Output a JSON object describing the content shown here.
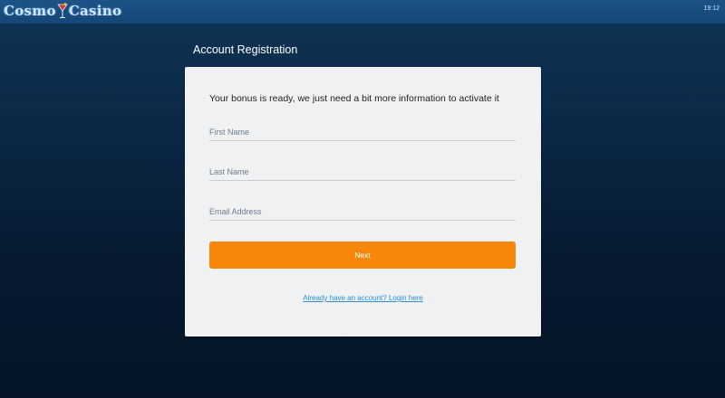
{
  "header": {
    "logo_text_left": "Cosmo",
    "logo_text_right": "Casino",
    "clock": "19:12"
  },
  "page": {
    "title": "Account Registration"
  },
  "form": {
    "heading": "Your bonus is ready, we just need a bit more information to activate it",
    "first_name_placeholder": "First Name",
    "last_name_placeholder": "Last Name",
    "email_placeholder": "Email Address",
    "next_label": "Next",
    "login_link": "Already have an account? Login here"
  },
  "colors": {
    "accent_button": "#f7870a",
    "link": "#2d8fd0",
    "topbar": "#1a4c80",
    "background": "#0b2440"
  },
  "icons": {
    "logo_glass": "cocktail-glass-icon"
  }
}
